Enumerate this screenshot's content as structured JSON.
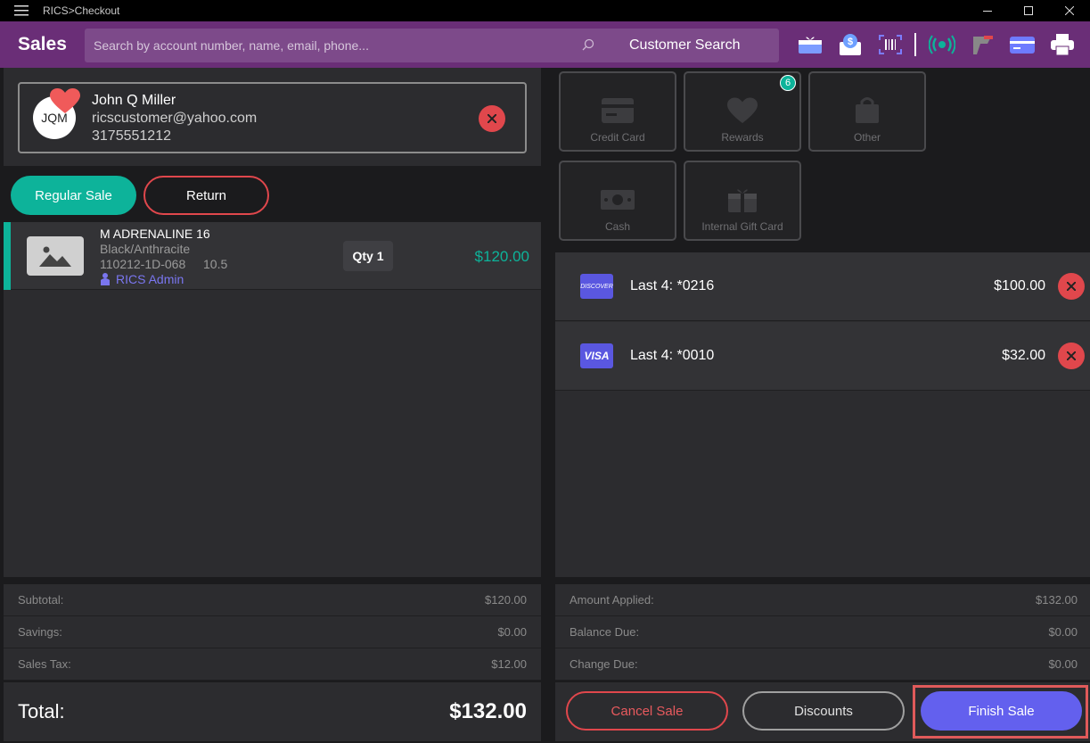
{
  "window": {
    "title": "RICS>Checkout"
  },
  "header": {
    "brand": "Sales",
    "search_placeholder": "Search by account number, name, email, phone...",
    "customer_search_label": "Customer Search",
    "icons": [
      "gift-card-icon",
      "cash-envelope-icon",
      "barcode-scan-icon",
      "broadcast-icon",
      "card-reader-icon",
      "credit-card-icon",
      "printer-icon"
    ]
  },
  "customer": {
    "initials": "JQM",
    "name": "John Q Miller",
    "email": "ricscustomer@yahoo.com",
    "phone": "3175551212"
  },
  "sale_modes": {
    "regular": "Regular Sale",
    "return": "Return"
  },
  "items": [
    {
      "name": "M ADRENALINE 16",
      "color": "Black/Anthracite",
      "sku": "110212-1D-068",
      "size": "10.5",
      "salesperson": "RICS Admin",
      "qty": "Qty 1",
      "price": "$120.00"
    }
  ],
  "totals": {
    "subtotal_label": "Subtotal:",
    "subtotal": "$120.00",
    "savings_label": "Savings:",
    "savings": "$0.00",
    "tax_label": "Sales Tax:",
    "tax": "$12.00",
    "total_label": "Total:",
    "total": "$132.00"
  },
  "tenders": {
    "credit_card": "Credit Card",
    "rewards": "Rewards",
    "rewards_badge": "6",
    "other": "Other",
    "cash": "Cash",
    "gift_card": "Internal Gift Card"
  },
  "payments": [
    {
      "brand": "DISCOVER",
      "last4": "Last 4: *0216",
      "amount": "$100.00",
      "color": "#5a57e0"
    },
    {
      "brand": "VISA",
      "last4": "Last 4: *0010",
      "amount": "$32.00",
      "color": "#5a57e0"
    }
  ],
  "summary": {
    "applied_label": "Amount Applied:",
    "applied": "$132.00",
    "balance_label": "Balance Due:",
    "balance": "$0.00",
    "change_label": "Change Due:",
    "change": "$0.00"
  },
  "actions": {
    "cancel": "Cancel Sale",
    "discounts": "Discounts",
    "finish": "Finish Sale"
  },
  "colors": {
    "accent_green": "#0db39a",
    "brand_purple": "#6a2e77",
    "danger": "#e0474c",
    "primary": "#6360ee"
  }
}
